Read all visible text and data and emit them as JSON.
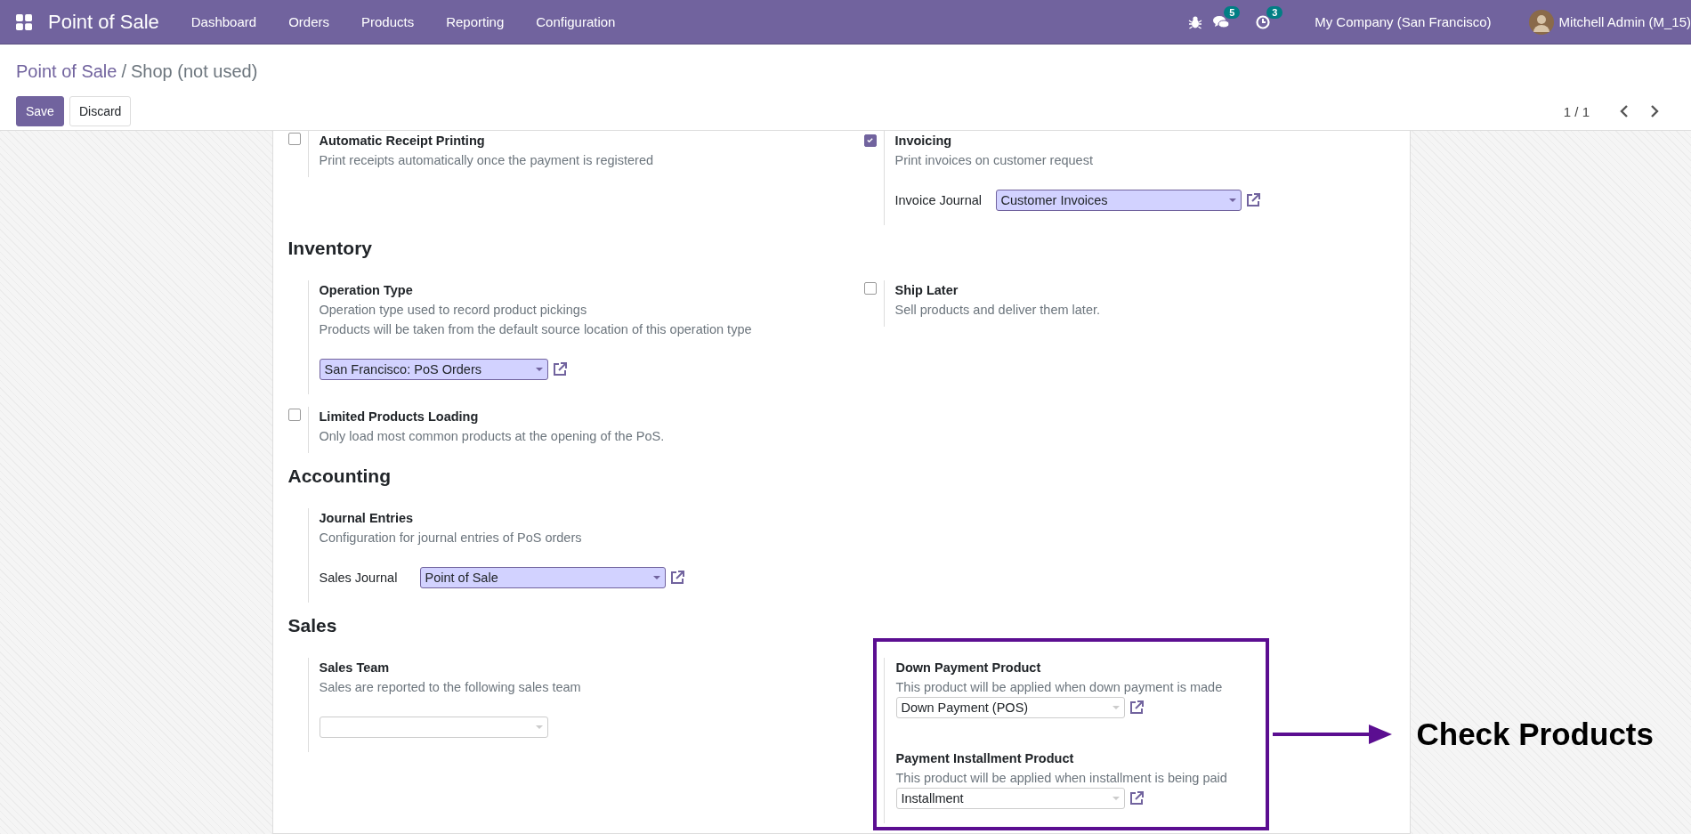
{
  "navbar": {
    "app_title": "Point of Sale",
    "menu": [
      "Dashboard",
      "Orders",
      "Products",
      "Reporting",
      "Configuration"
    ],
    "messages_count": "5",
    "activities_count": "3",
    "company": "My Company (San Francisco)",
    "user": "Mitchell Admin (M_15)"
  },
  "breadcrumb": [
    {
      "label": "Point of Sale",
      "link": true
    },
    {
      "label": "Shop (not used)",
      "link": false
    }
  ],
  "breadcrumb_separator": "/",
  "buttons": [
    {
      "label": "Save",
      "kind": "primary"
    },
    {
      "label": "Discard",
      "kind": "secondary"
    }
  ],
  "pager": "1 / 1",
  "sections": [
    {
      "rows": [
        {
          "left": {
            "items": [
              {
                "kind": "checkbox",
                "checked": false,
                "title": "Automatic Receipt Printing",
                "description": [
                  "Print receipts automatically once the payment is registered"
                ]
              }
            ]
          },
          "right": {
            "items": [
              {
                "kind": "checkbox",
                "checked": true,
                "title": "Invoicing",
                "description": [
                  "Print invoices on customer request"
                ],
                "field": {
                  "label": "Invoice Journal",
                  "value": "Customer Invoices",
                  "required": true,
                  "link_icon": true
                }
              }
            ]
          }
        }
      ]
    },
    {
      "heading": "Inventory",
      "rows": [
        {
          "left": {
            "items": [
              {
                "kind": "plain",
                "title": "Operation Type",
                "description": [
                  "Operation type used to record product pickings",
                  "Products will be taken from the default source location of this operation type"
                ],
                "field": {
                  "value": "San Francisco: PoS Orders",
                  "required": true,
                  "link_icon": true
                }
              }
            ]
          },
          "right": {
            "items": [
              {
                "kind": "checkbox",
                "checked": false,
                "title": "Ship Later",
                "description": [
                  "Sell products and deliver them later."
                ]
              }
            ]
          }
        },
        {
          "left": {
            "items": [
              {
                "kind": "checkbox",
                "checked": false,
                "title": "Limited Products Loading",
                "description": [
                  "Only load most common products at the opening of the PoS."
                ]
              }
            ]
          }
        }
      ]
    },
    {
      "heading": "Accounting",
      "rows": [
        {
          "left": {
            "items": [
              {
                "kind": "plain",
                "title": "Journal Entries",
                "description": [
                  "Configuration for journal entries of PoS orders"
                ],
                "field": {
                  "label": "Sales Journal",
                  "value": "Point of Sale",
                  "required": true,
                  "link_icon": true
                }
              }
            ]
          }
        }
      ]
    },
    {
      "heading": "Sales",
      "rows": [
        {
          "left": {
            "items": [
              {
                "kind": "plain",
                "title": "Sales Team",
                "description": [
                  "Sales are reported to the following sales team"
                ],
                "field": {
                  "required": false,
                  "link_icon": false
                }
              }
            ]
          },
          "right": {
            "highlighted": true,
            "note": "Check Products",
            "items": [
              {
                "kind": "plain",
                "title": "Down Payment Product",
                "description": [
                  "This product will be applied when down payment is made"
                ],
                "field": {
                  "value": "Down Payment (POS)",
                  "required": false,
                  "link_icon": true
                }
              },
              {
                "kind": "plain",
                "title": "Payment Installment Product",
                "description": [
                  "This product will be applied when installment is being paid"
                ],
                "field": {
                  "value": "Installment",
                  "required": false,
                  "link_icon": true
                }
              }
            ]
          }
        }
      ]
    }
  ]
}
